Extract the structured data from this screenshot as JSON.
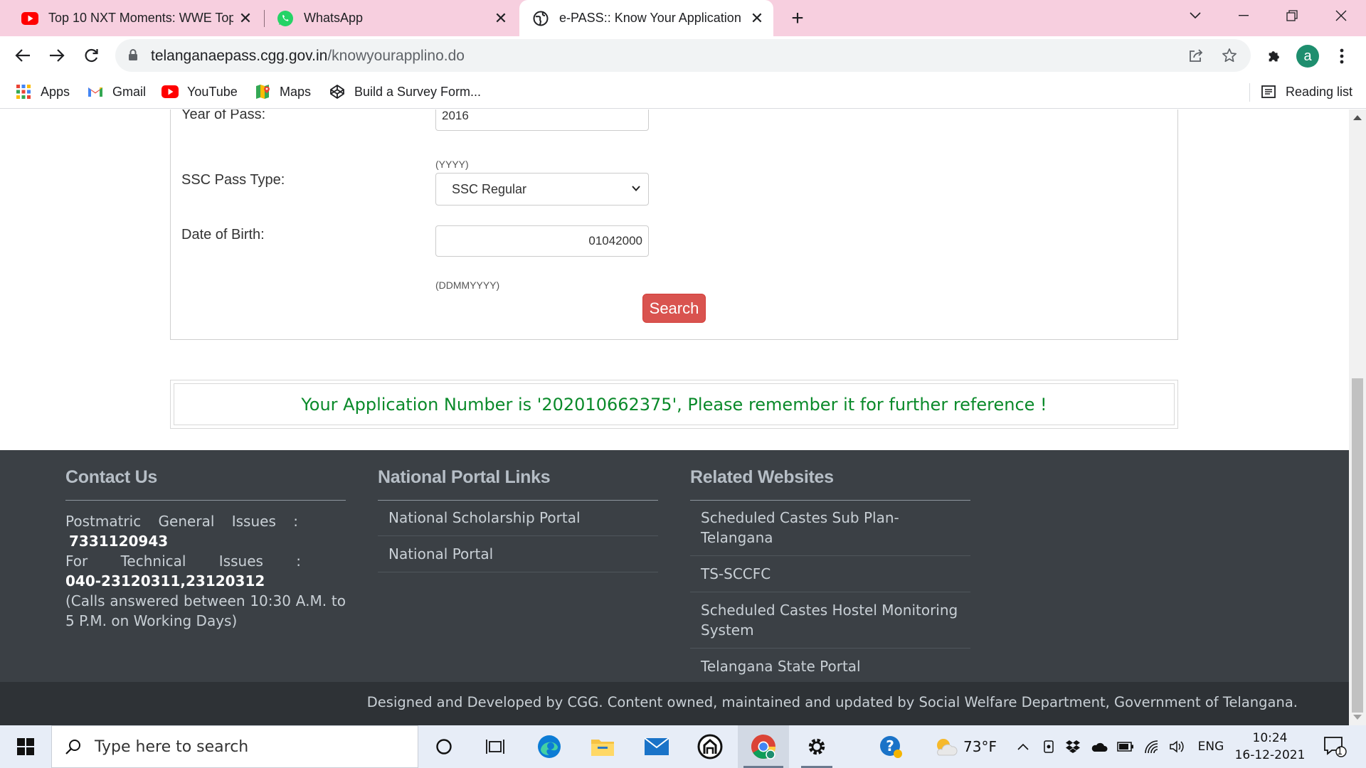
{
  "browser": {
    "tabs": [
      {
        "title": "Top 10 NXT Moments: WWE Top",
        "icon": "youtube-icon"
      },
      {
        "title": "WhatsApp",
        "icon": "whatsapp-icon"
      },
      {
        "title": "e-PASS:: Know Your Application N",
        "icon": "globe-icon",
        "active": true
      }
    ],
    "url_host": "telanganaepass.cgg.gov.in",
    "url_path": "/knowyourapplino.do",
    "profile_initial": "a",
    "bookmarks": [
      {
        "label": "Apps",
        "icon": "apps-grid-icon"
      },
      {
        "label": "Gmail",
        "icon": "gmail-icon"
      },
      {
        "label": "YouTube",
        "icon": "youtube-icon"
      },
      {
        "label": "Maps",
        "icon": "maps-icon"
      },
      {
        "label": "Build a Survey Form...",
        "icon": "codepen-icon"
      }
    ],
    "reading_list": "Reading list"
  },
  "form": {
    "year_label": "Year of Pass:",
    "year_value": "2016",
    "year_hint": "(YYYY)",
    "ssc_label": "SSC Pass Type:",
    "ssc_value": "SSC Regular",
    "dob_label": "Date of Birth:",
    "dob_value": "01042000",
    "dob_hint": "(DDMMYYYY)",
    "search_label": "Search"
  },
  "message": "Your Application Number is '202010662375', Please remember it for further reference !",
  "footer": {
    "contact": {
      "title": "Contact Us",
      "line1": "Postmatric General Issues :",
      "phone1": "7331120943",
      "line2": "For Technical Issues :",
      "phone2": "040-23120311,23120312",
      "note": "(Calls answered between 10:30 A.M. to 5 P.M. on Working Days)"
    },
    "national": {
      "title": "National Portal Links",
      "links": [
        "National Scholarship Portal",
        "National Portal"
      ]
    },
    "related": {
      "title": "Related Websites",
      "links": [
        "Scheduled Castes Sub Plan-Telangana",
        "TS-SCCFC",
        "Scheduled Castes Hostel Monitoring System",
        "Telangana State Portal"
      ]
    },
    "copyright": "Designed and Developed by CGG. Content owned, maintained and updated by Social Welfare Department, Government of Telangana."
  },
  "taskbar": {
    "search_placeholder": "Type here to search",
    "weather": "73°F",
    "language": "ENG",
    "time": "10:24",
    "date": "16-12-2021",
    "notification_count": "1"
  },
  "colors": {
    "tabstrip": "#f7cfdf",
    "success_text": "#0a8a2a",
    "search_button": "#d9534f",
    "footer_bg": "#3b4045"
  }
}
